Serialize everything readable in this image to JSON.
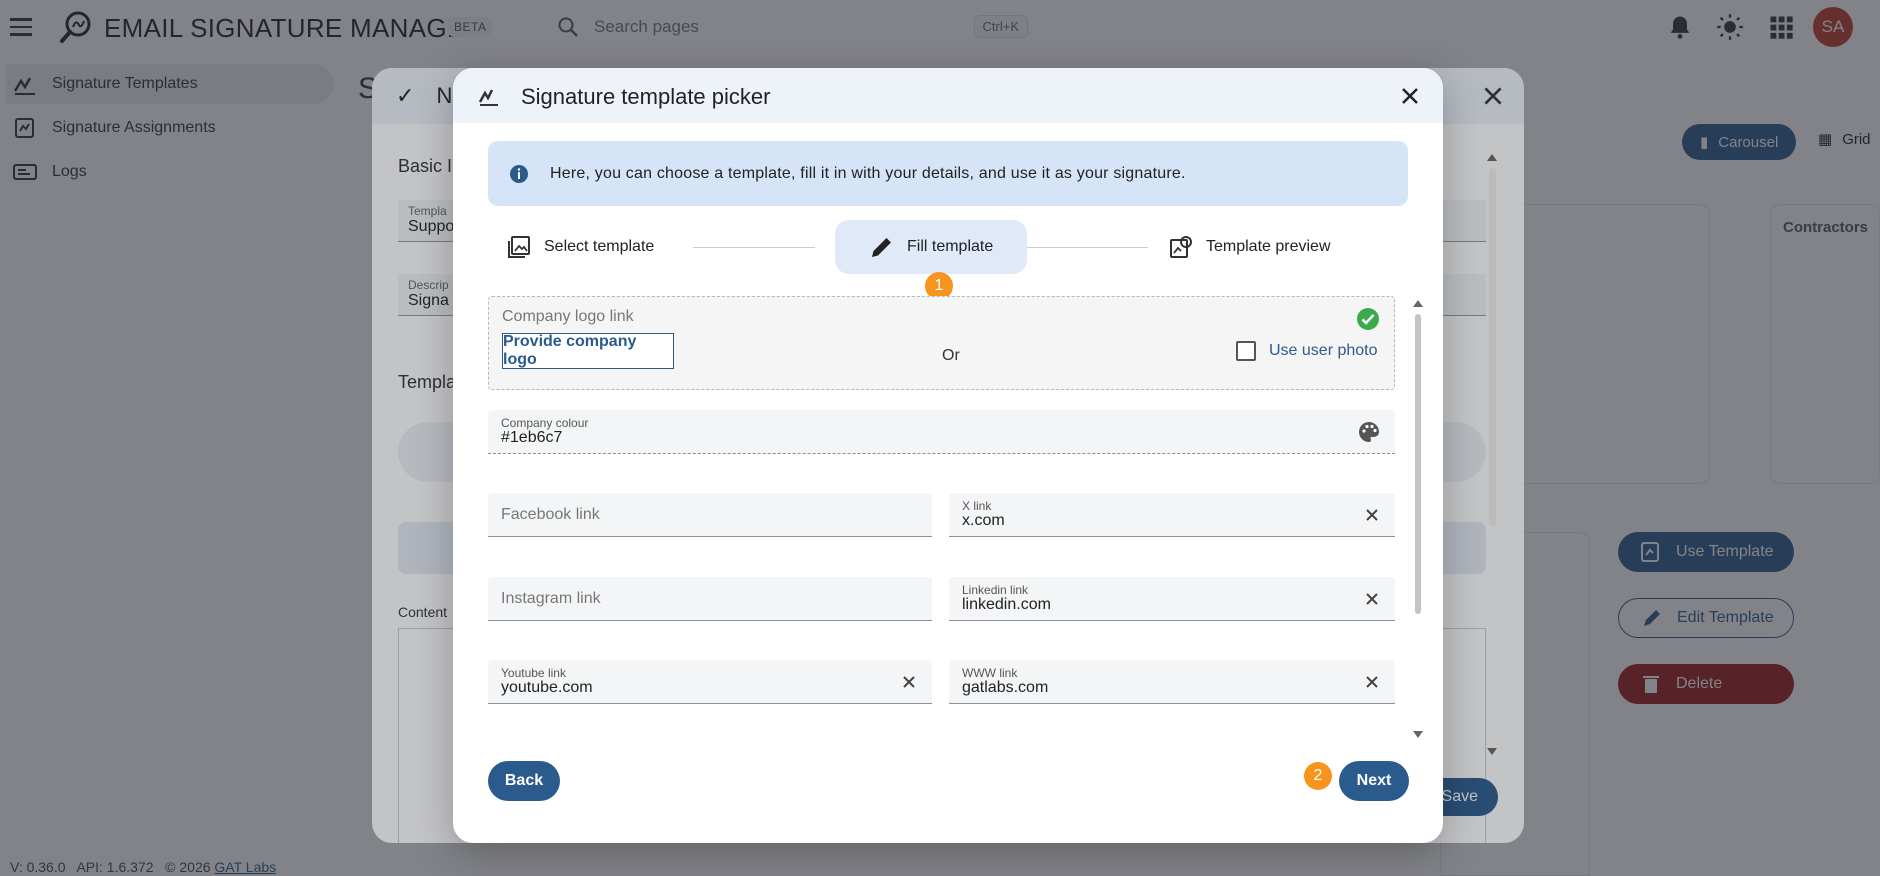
{
  "app": {
    "title": "EMAIL SIGNATURE MANAGER",
    "beta": "BETA"
  },
  "search": {
    "placeholder": "Search pages",
    "shortcut": "Ctrl+K"
  },
  "user": {
    "initials": "SA"
  },
  "sidebar": {
    "items": [
      {
        "label": "Signature Templates",
        "icon": "signature-icon",
        "active": true
      },
      {
        "label": "Signature Assignments",
        "icon": "assignment-icon",
        "active": false
      },
      {
        "label": "Logs",
        "icon": "logs-icon",
        "active": false
      }
    ]
  },
  "footer": {
    "version": "V: 0.36.0",
    "api": "API: 1.6.372",
    "copyright": "© 2026",
    "company": "GAT Labs"
  },
  "background": {
    "page_title": "Si",
    "carousel": "Carousel",
    "grid": "Grid",
    "contractors": "Contractors",
    "use_template": "Use Template",
    "edit_template": "Edit Template",
    "delete": "Delete"
  },
  "mid_modal": {
    "title": "N",
    "basic": "Basic I",
    "template_label": "Templa",
    "template_value": "Suppo",
    "desc_label": "Descrip",
    "desc_value": "Signa",
    "template_section": "Templa",
    "content": "Content",
    "save": "Save"
  },
  "modal": {
    "title": "Signature template picker",
    "info": "Here, you can choose a template, fill it in with your details, and use it as your signature.",
    "steps": [
      {
        "label": "Select template",
        "icon": "image-icon"
      },
      {
        "label": "Fill template",
        "icon": "pencil-icon"
      },
      {
        "label": "Template preview",
        "icon": "preview-icon"
      }
    ],
    "step_badge": "1",
    "next_badge": "2",
    "logo": {
      "label": "Company logo link",
      "button": "Provide company logo",
      "or": "Or",
      "use_user_photo": "Use user photo",
      "use_user_photo_checked": false
    },
    "colour": {
      "label": "Company colour",
      "value": "#1eb6c7"
    },
    "fields": {
      "facebook": {
        "placeholder": "Facebook link",
        "value": ""
      },
      "x": {
        "label": "X link",
        "value": "x.com"
      },
      "instagram": {
        "placeholder": "Instagram link",
        "value": ""
      },
      "linkedin": {
        "label": "Linkedin link",
        "value": "linkedin.com"
      },
      "youtube": {
        "label": "Youtube link",
        "value": "youtube.com"
      },
      "www": {
        "label": "WWW link",
        "value": "gatlabs.com"
      }
    },
    "back": "Back",
    "next": "Next"
  },
  "colors": {
    "primary": "#2a5b8c",
    "badge": "#f7941d",
    "info_bg": "#d6e4f7",
    "success": "#3aaa4a",
    "danger": "#9b1b1b"
  }
}
